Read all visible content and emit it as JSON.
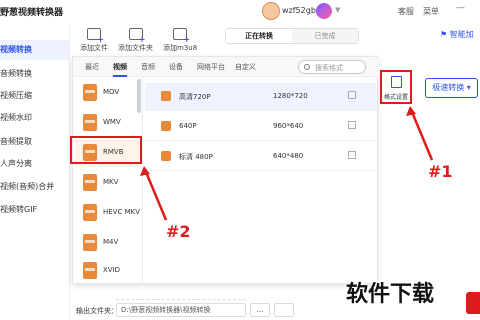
{
  "topbar": {
    "app_title": "野葱视频转换器",
    "username": "wzf52gb",
    "service_label": "客服",
    "menu_label": "菜单",
    "minimize_label": "—"
  },
  "sidebar": {
    "items": [
      {
        "label": "视频转换",
        "active": true
      },
      {
        "label": "音频转换"
      },
      {
        "label": "视频压缩"
      },
      {
        "label": "视频水印"
      },
      {
        "label": "音频提取"
      },
      {
        "label": "人声分离"
      },
      {
        "label": "视频(音频)合并"
      },
      {
        "label": "视频转GIF"
      }
    ]
  },
  "toolbar": {
    "add_file": "添加文件",
    "add_folder": "添加文件夹",
    "add_m3u8": "添加m3u8",
    "tab_converting": "正在转换",
    "tab_done": "已完成",
    "smart_label": "智能加"
  },
  "format_popup": {
    "tabs": [
      "最近",
      "视频",
      "音频",
      "设备",
      "网络平台",
      "自定义"
    ],
    "active_tab": "视频",
    "search_placeholder": "搜索格式",
    "formats": [
      "MOV",
      "WMV",
      "RMVB",
      "MKV",
      "HEVC MKV",
      "M4V",
      "XVID"
    ],
    "selected_format": "RMVB",
    "resolutions": [
      {
        "name": "高清720P",
        "size": "1280*720"
      },
      {
        "name": "640P",
        "size": "960*640"
      },
      {
        "name": "标清 480P",
        "size": "640*480"
      }
    ]
  },
  "format_settings": {
    "label": "格式设置"
  },
  "conversion": {
    "fast_convert_label": "极速转换"
  },
  "annotations": {
    "label1": "#1",
    "label2": "#2"
  },
  "bottom": {
    "output_label": "输出文件夹：",
    "output_path": "D:\\野葱视频转换器\\视频转换",
    "browse_label": "..."
  },
  "watermark": {
    "text": "软件下载"
  },
  "colors": {
    "accent": "#2f54eb",
    "highlight": "#e01b1b",
    "format_icon": "#e88a3a"
  }
}
